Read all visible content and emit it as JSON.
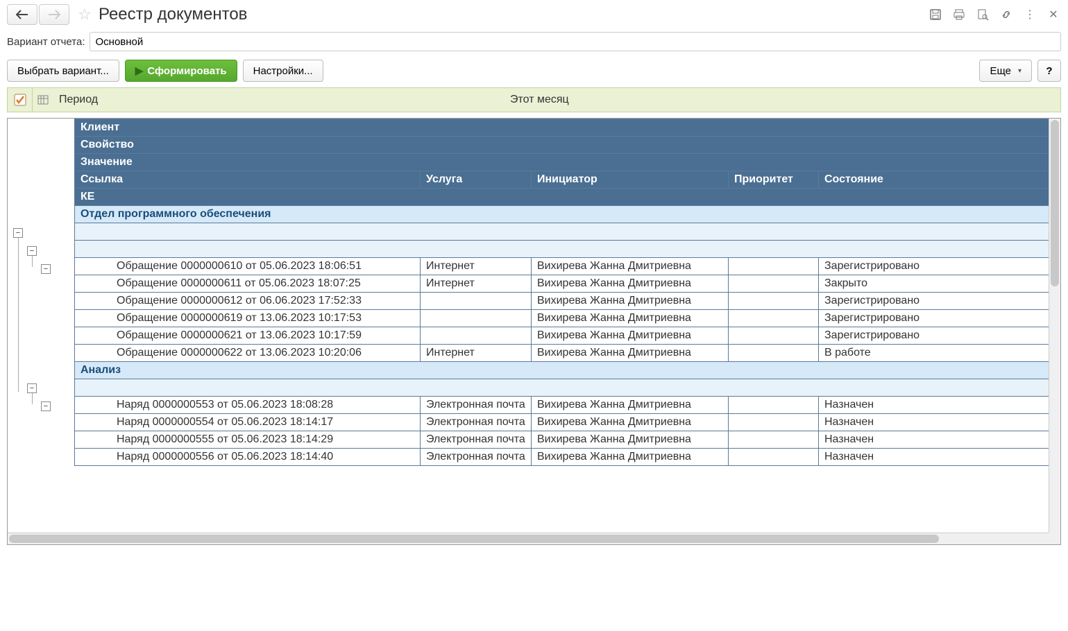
{
  "header": {
    "title": "Реестр документов"
  },
  "variant": {
    "label": "Вариант отчета:",
    "value": "Основной"
  },
  "toolbar": {
    "select_variant": "Выбрать вариант...",
    "generate": "Сформировать",
    "settings": "Настройки...",
    "more": "Еще",
    "help": "?"
  },
  "filter": {
    "label": "Период",
    "value": "Этот месяц"
  },
  "report": {
    "header_rows": [
      "Клиент",
      "Свойство",
      "Значение"
    ],
    "columns": {
      "reference": "Ссылка",
      "service": "Услуга",
      "initiator": "Инициатор",
      "priority": "Приоритет",
      "state": "Состояние"
    },
    "ke_row": "КЕ",
    "group1": {
      "name": "Отдел программного обеспечения",
      "rows": [
        {
          "ref": "Обращение 0000000610 от 05.06.2023 18:06:51",
          "srv": "Интернет",
          "ini": "Вихирева Жанна Дмитриевна",
          "pri": "",
          "sta": "Зарегистрировано"
        },
        {
          "ref": "Обращение 0000000611 от 05.06.2023 18:07:25",
          "srv": "Интернет",
          "ini": "Вихирева Жанна Дмитриевна",
          "pri": "",
          "sta": "Закрыто"
        },
        {
          "ref": "Обращение 0000000612 от 06.06.2023 17:52:33",
          "srv": "",
          "ini": "Вихирева Жанна Дмитриевна",
          "pri": "",
          "sta": "Зарегистрировано"
        },
        {
          "ref": "Обращение 0000000619 от 13.06.2023 10:17:53",
          "srv": "",
          "ini": "Вихирева Жанна Дмитриевна",
          "pri": "",
          "sta": "Зарегистрировано"
        },
        {
          "ref": "Обращение 0000000621 от 13.06.2023 10:17:59",
          "srv": "",
          "ini": "Вихирева Жанна Дмитриевна",
          "pri": "",
          "sta": "Зарегистрировано"
        },
        {
          "ref": "Обращение 0000000622 от 13.06.2023 10:20:06",
          "srv": "Интернет",
          "ini": "Вихирева Жанна Дмитриевна",
          "pri": "",
          "sta": "В работе"
        }
      ]
    },
    "group2": {
      "name": "Анализ",
      "rows": [
        {
          "ref": "Наряд 0000000553 от 05.06.2023 18:08:28",
          "srv": "Электронная почта",
          "ini": "Вихирева Жанна Дмитриевна",
          "pri": "",
          "sta": "Назначен"
        },
        {
          "ref": "Наряд 0000000554 от 05.06.2023 18:14:17",
          "srv": "Электронная почта",
          "ini": "Вихирева Жанна Дмитриевна",
          "pri": "",
          "sta": "Назначен"
        },
        {
          "ref": "Наряд 0000000555 от 05.06.2023 18:14:29",
          "srv": "Электронная почта",
          "ini": "Вихирева Жанна Дмитриевна",
          "pri": "",
          "sta": "Назначен"
        },
        {
          "ref": "Наряд 0000000556 от 05.06.2023 18:14:40",
          "srv": "Электронная почта",
          "ini": "Вихирева Жанна Дмитриевна",
          "pri": "",
          "sta": "Назначен"
        }
      ]
    }
  }
}
